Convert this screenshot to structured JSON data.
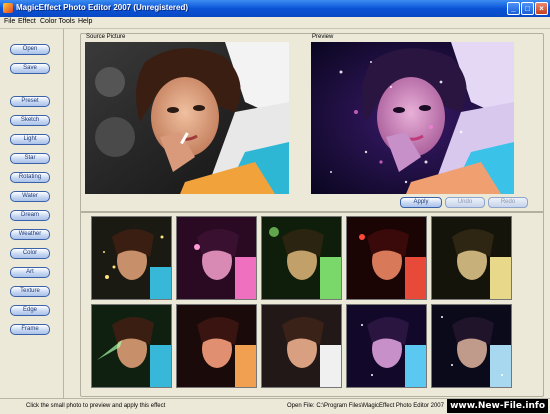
{
  "window": {
    "title": "MagicEffect Photo Editor 2007 (Unregistered)"
  },
  "menu": [
    "File",
    "Effect",
    "Color Tools",
    "Help"
  ],
  "left_panel": {
    "file_buttons": [
      "Open",
      "Save"
    ],
    "effect_buttons": [
      "Preset",
      "Sketch",
      "Light",
      "Star",
      "Rotating",
      "Water",
      "Dream",
      "Weather",
      "Color",
      "Art",
      "Texture",
      "Edge",
      "Frame"
    ]
  },
  "source": {
    "label": "Source Picture"
  },
  "preview": {
    "label": "Preview"
  },
  "actions": {
    "apply": "Apply",
    "undo": "Undo",
    "redo": "Redo"
  },
  "thumbnails_count": 10,
  "status": {
    "hint": "Click the small photo to preview and apply this effect",
    "open_file": "Open File: C:\\Program Files\\MagicEffect Photo Editor 2007"
  },
  "watermark": "www.New-File.info",
  "colors": {
    "titlebar": "#0a54d6",
    "accent": "#3b62a8"
  }
}
